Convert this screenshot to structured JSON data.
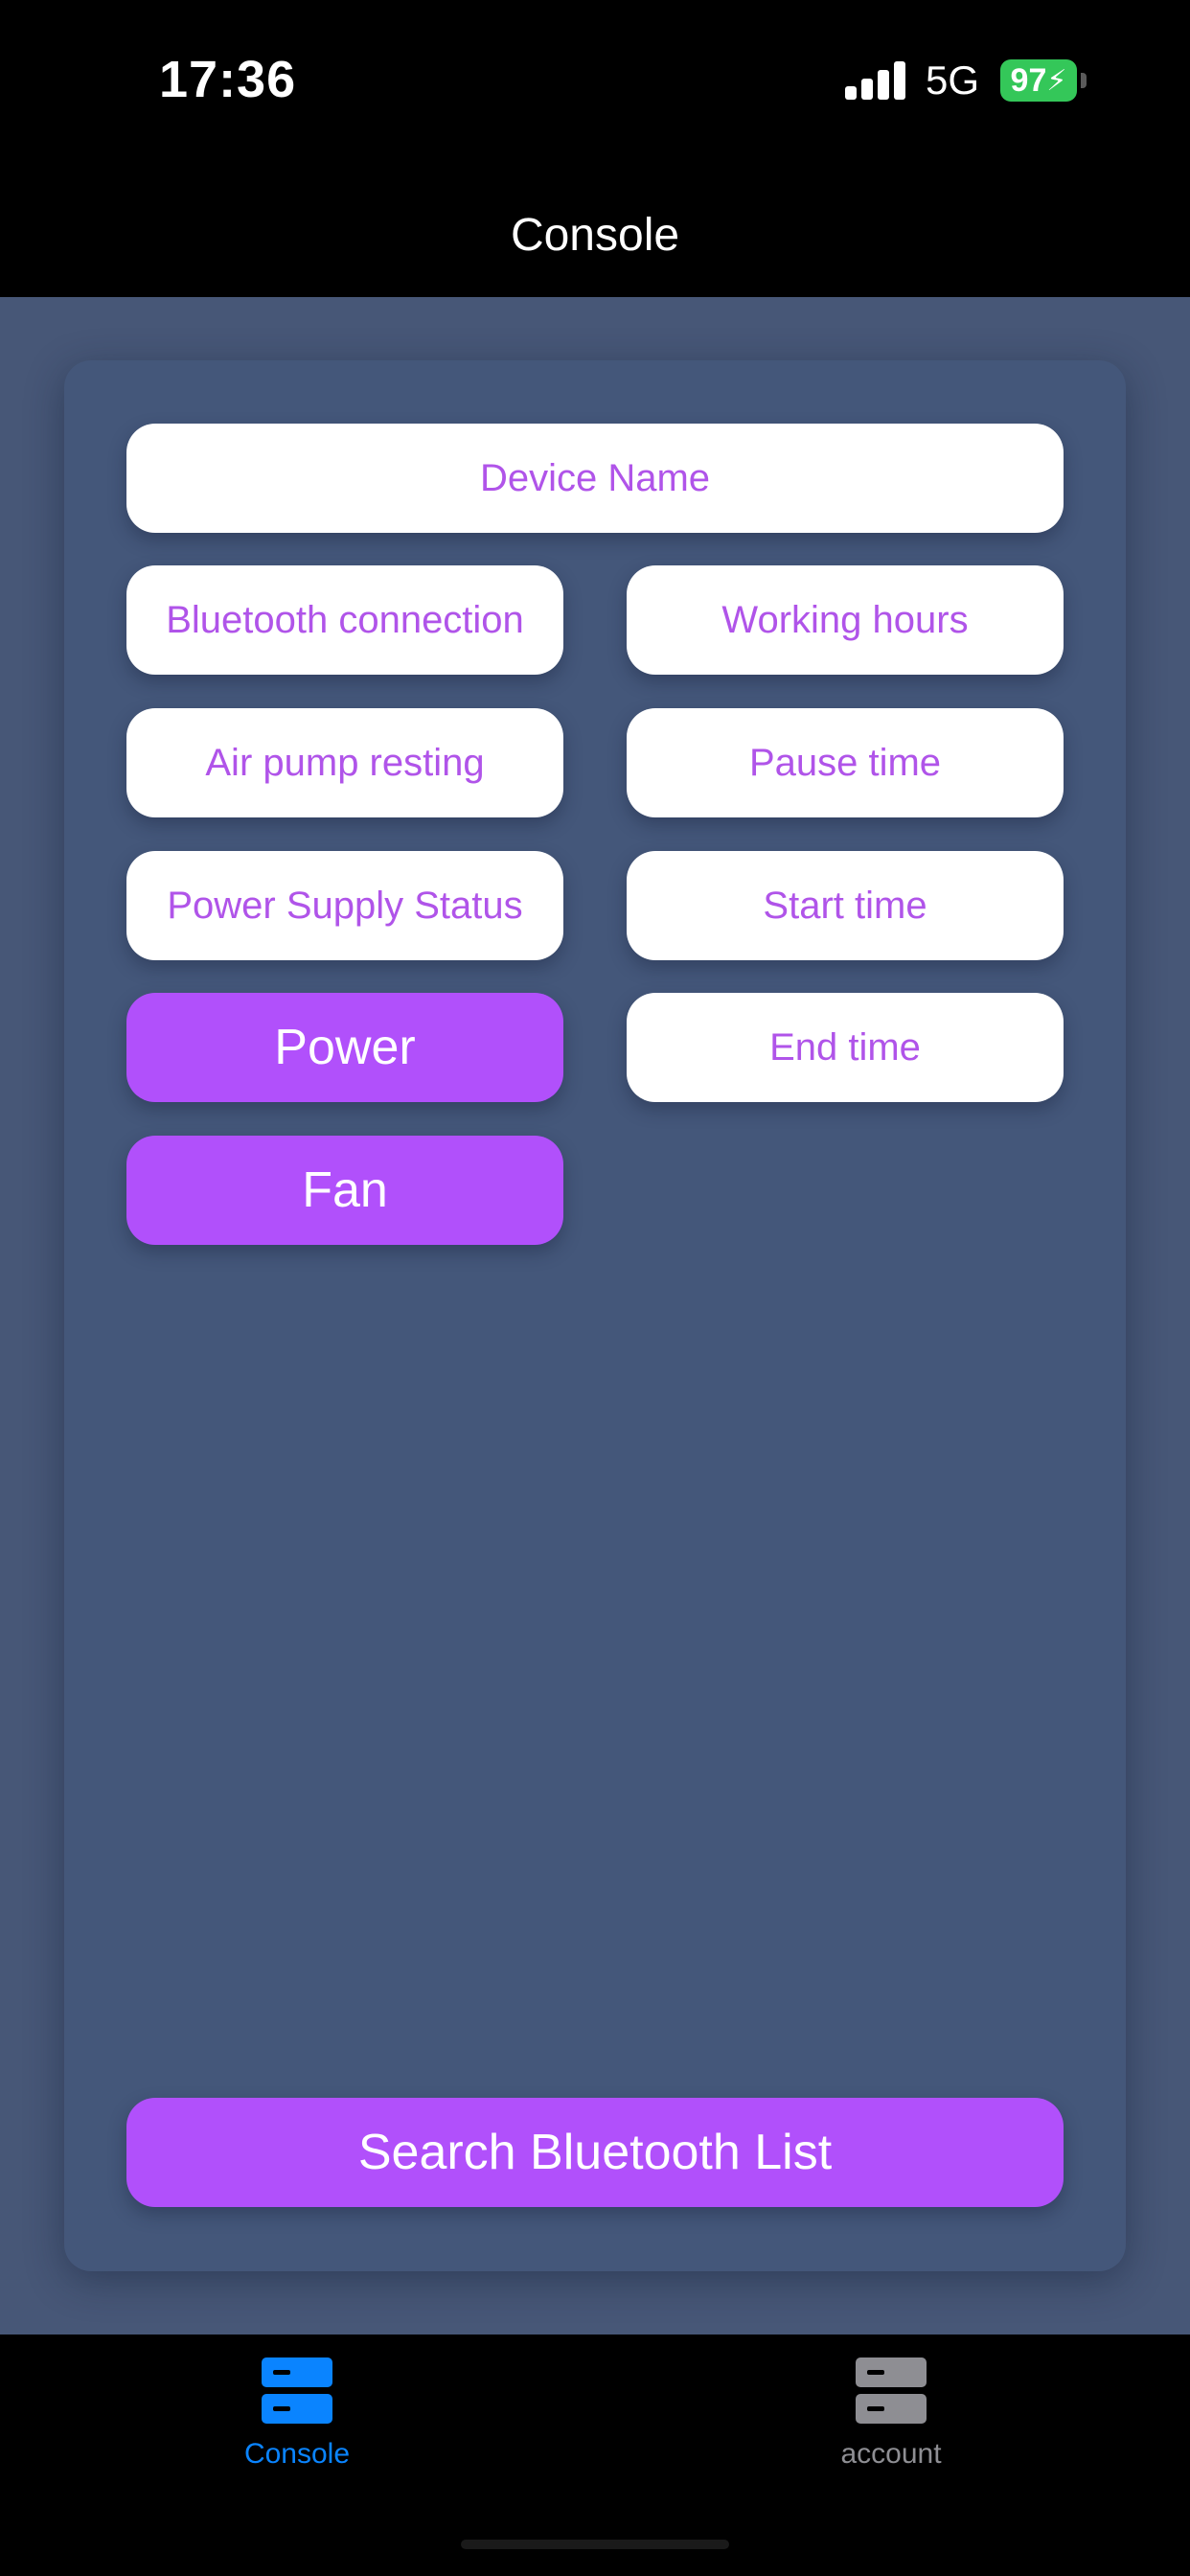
{
  "status_bar": {
    "time": "17:36",
    "network": "5G",
    "battery": "97"
  },
  "nav": {
    "title": "Console"
  },
  "card": {
    "device_name": "Device Name",
    "bluetooth_connection": "Bluetooth connection",
    "working_hours": "Working hours",
    "air_pump_resting": "Air pump resting",
    "pause_time": "Pause time",
    "power_supply_status": "Power Supply Status",
    "start_time": "Start time",
    "power": "Power",
    "end_time": "End time",
    "fan": "Fan",
    "search_bluetooth_list": "Search Bluetooth List"
  },
  "tabs": [
    {
      "label": "Console",
      "active": true,
      "icon": "server-icon",
      "color": "#0a84ff"
    },
    {
      "label": "account",
      "active": false,
      "icon": "server-icon",
      "color": "#8e8e93"
    }
  ],
  "colors": {
    "accent_purple": "#b150fb",
    "label_purple": "#b054e9",
    "background": "#475777",
    "battery_green": "#34c759"
  }
}
